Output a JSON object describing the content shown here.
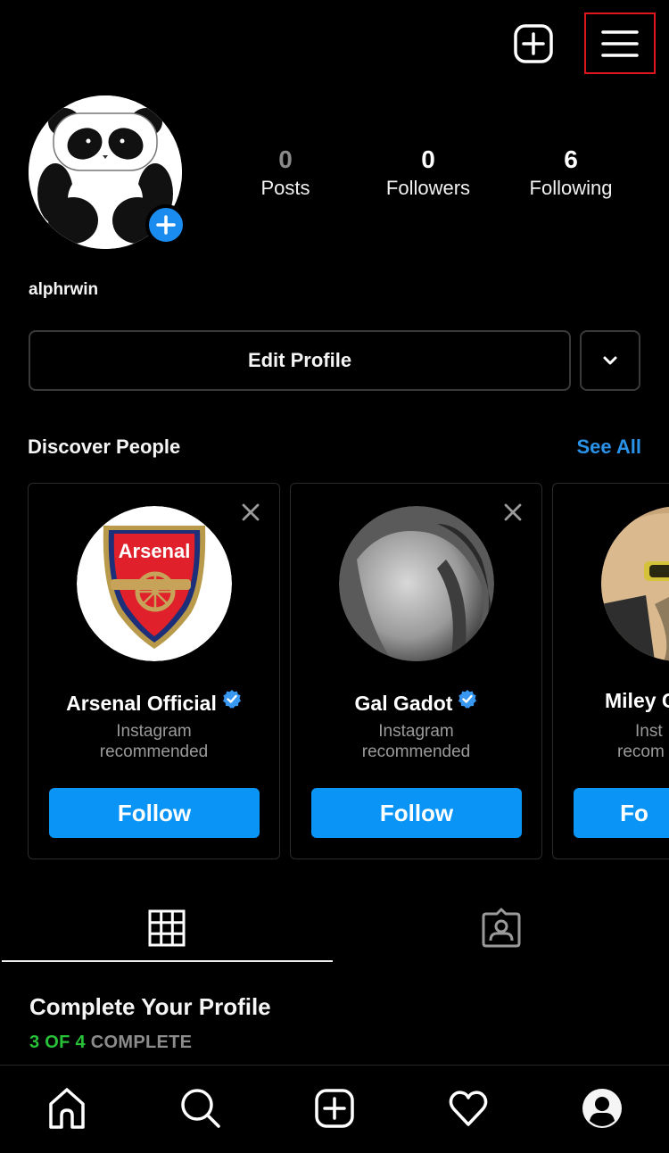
{
  "header": {
    "new_post_icon": "plus-square-icon",
    "menu_icon": "hamburger-menu-icon",
    "menu_highlight_color": "#e0161e"
  },
  "profile": {
    "username": "alphrwin",
    "avatar": "panda-avatar",
    "add_story_icon": "plus-circle-icon",
    "stats": [
      {
        "value": "0",
        "label": "Posts"
      },
      {
        "value": "0",
        "label": "Followers"
      },
      {
        "value": "6",
        "label": "Following"
      }
    ],
    "edit_profile_label": "Edit Profile",
    "more_icon": "chevron-down-icon"
  },
  "discover": {
    "title": "Discover People",
    "see_all_label": "See All",
    "accent_color": "#0a95f6",
    "cards": [
      {
        "name": "Arsenal Official",
        "verified": true,
        "subtitle_line1": "Instagram",
        "subtitle_line2": "recommended",
        "follow_label": "Follow"
      },
      {
        "name": "Gal Gadot",
        "verified": true,
        "subtitle_line1": "Instagram",
        "subtitle_line2": "recommended",
        "follow_label": "Follow"
      },
      {
        "name": "Miley C",
        "verified": false,
        "subtitle_line1": "Inst",
        "subtitle_line2": "recom",
        "follow_label": "Fo"
      }
    ]
  },
  "tabs": [
    {
      "name": "grid",
      "icon": "grid-icon",
      "active": true
    },
    {
      "name": "tagged",
      "icon": "tagged-person-icon",
      "active": false
    }
  ],
  "complete_profile": {
    "title": "Complete Your Profile",
    "progress_done": "3 OF 4",
    "progress_rest": "COMPLETE",
    "progress_fraction": 0.75,
    "done_color": "#27c237"
  },
  "bottom_nav": [
    {
      "name": "home",
      "icon": "home-icon"
    },
    {
      "name": "search",
      "icon": "search-icon"
    },
    {
      "name": "new-post",
      "icon": "plus-square-icon"
    },
    {
      "name": "activity",
      "icon": "heart-icon"
    },
    {
      "name": "profile",
      "icon": "profile-icon"
    }
  ]
}
